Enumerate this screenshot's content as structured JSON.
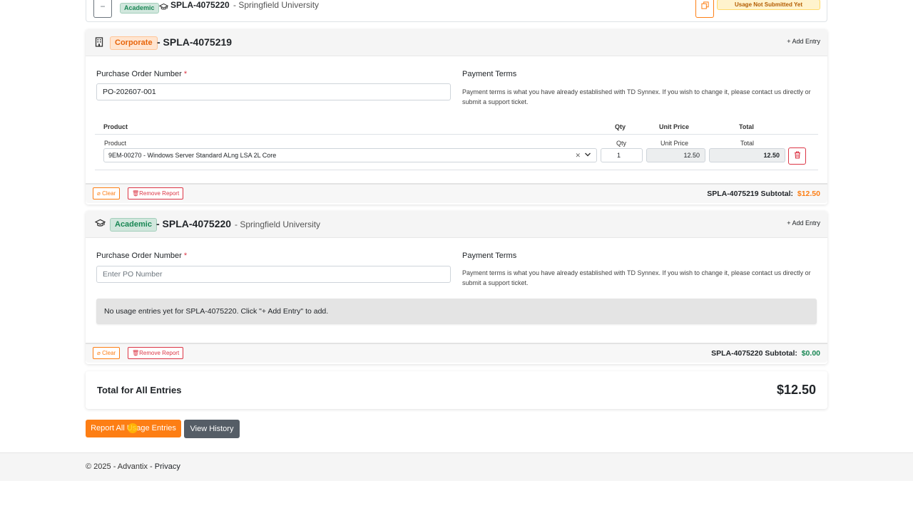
{
  "top_card": {
    "collapse_symbol": "−",
    "badge": "Academic",
    "spla": "SPLA-4075220",
    "org": "- Springfield University",
    "status": "Usage Not Submitted Yet"
  },
  "corporate_card": {
    "icon": "building-icon",
    "badge": "Corporate",
    "title": "- SPLA-4075219",
    "add_entry": "+ Add Entry",
    "po_label": "Purchase Order Number",
    "required_mark": "*",
    "po_value": "PO-202607-001",
    "payment_label": "Payment Terms",
    "payment_text": "Payment terms is what you have already established with TD Synnex. If you wish to change it, please contact us directly or submit a support ticket.",
    "table": {
      "headers": [
        "Product",
        "Qty",
        "Unit Price",
        "Total"
      ],
      "rows": [
        {
          "product_label": "Product",
          "product": "9EM-00270 - Windows Server Standard ALng LSA 2L Core",
          "qty_label": "Qty",
          "qty": "1",
          "unit_price_label": "Unit Price",
          "unit_price": "12.50",
          "total_label": "Total",
          "total": "12.50"
        }
      ]
    },
    "clear": "Clear",
    "remove": "Remove Report",
    "subtotal_label": "SPLA-4075219 Subtotal:",
    "subtotal_value": "$12.50"
  },
  "academic_card": {
    "icon": "graduation-cap-icon",
    "badge": "Academic",
    "title": "- SPLA-4075220",
    "org": "- Springfield University",
    "add_entry": "+ Add Entry",
    "po_label": "Purchase Order Number",
    "required_mark": "*",
    "po_placeholder": "Enter PO Number",
    "payment_label": "Payment Terms",
    "payment_text": "Payment terms is what you have already established with TD Synnex. If you wish to change it, please contact us directly or submit a support ticket.",
    "empty_text": "No usage entries yet for SPLA-4075220. Click \"+ Add Entry\" to add.",
    "clear": "Clear",
    "remove": "Remove Report",
    "subtotal_label": "SPLA-4075220 Subtotal:",
    "subtotal_value": "$0.00"
  },
  "totals": {
    "label": "Total for All Entries",
    "value": "$12.50"
  },
  "actions": {
    "report_all": "Report All Usage Entries",
    "view_history": "View History"
  },
  "footer": {
    "copyright": "© 2025 - Advantix - ",
    "privacy": "Privacy"
  },
  "colors": {
    "accent": "#fd7e14",
    "danger": "#dc3545",
    "success": "#198754",
    "secondary": "#555d66"
  }
}
